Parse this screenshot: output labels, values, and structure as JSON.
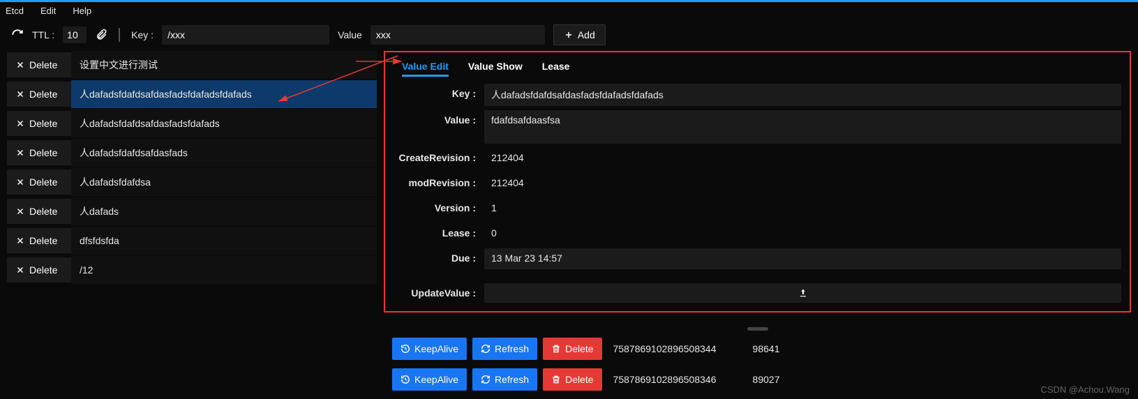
{
  "menu": {
    "etcd": "Etcd",
    "edit": "Edit",
    "help": "Help"
  },
  "toolbar": {
    "ttl_label": "TTL :",
    "ttl_value": "10",
    "key_label": "Key :",
    "key_value": "/xxx",
    "value_label": "Value",
    "value_value": "xxx",
    "add_label": "Add"
  },
  "delete_label": "Delete",
  "keys": [
    {
      "key": "设置中文进行测试",
      "selected": false
    },
    {
      "key": "人dafadsfdafdsafdasfadsfdafadsfdafads",
      "selected": true
    },
    {
      "key": "人dafadsfdafdsafdasfadsfdafads",
      "selected": false
    },
    {
      "key": "人dafadsfdafdsafdasfads",
      "selected": false
    },
    {
      "key": "人dafadsfdafdsa",
      "selected": false
    },
    {
      "key": "人dafads",
      "selected": false
    },
    {
      "key": "dfsfdsfda",
      "selected": false
    },
    {
      "key": "/12",
      "selected": false
    }
  ],
  "tabs": {
    "value_edit": "Value Edit",
    "value_show": "Value Show",
    "lease": "Lease"
  },
  "detail": {
    "key_label": "Key :",
    "key_value": "人dafadsfdafdsafdasfadsfdafadsfdafads",
    "value_label": "Value :",
    "value_value": "fdafdsafdaasfsa",
    "create_rev_label": "CreateRevision :",
    "create_rev_value": "212404",
    "mod_rev_label": "modRevision :",
    "mod_rev_value": "212404",
    "version_label": "Version :",
    "version_value": "1",
    "lease_label": "Lease :",
    "lease_value": "0",
    "due_label": "Due :",
    "due_value": "13 Mar 23 14:57",
    "update_label": "UpdateValue :"
  },
  "lease_btns": {
    "keep_alive": "KeepAlive",
    "refresh": "Refresh",
    "delete": "Delete"
  },
  "leases": [
    {
      "id": "7587869102896508344",
      "ttl": "98641"
    },
    {
      "id": "7587869102896508346",
      "ttl": "89027"
    }
  ],
  "watermark": "CSDN @Achou.Wang"
}
